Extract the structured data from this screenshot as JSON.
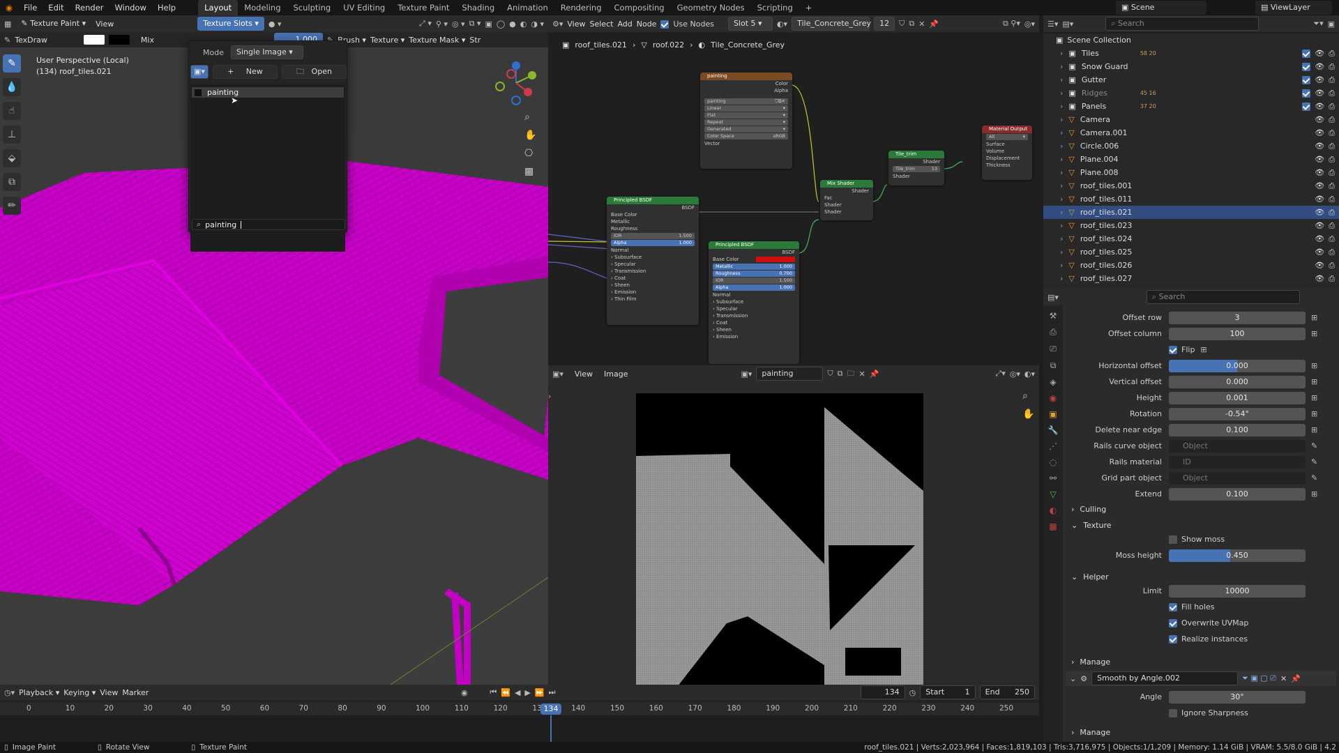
{
  "topbar": {
    "menus": [
      "File",
      "Edit",
      "Render",
      "Window",
      "Help"
    ],
    "workspaces": [
      "Layout",
      "Modeling",
      "Sculpting",
      "UV Editing",
      "Texture Paint",
      "Shading",
      "Animation",
      "Rendering",
      "Compositing",
      "Geometry Nodes",
      "Scripting"
    ],
    "active_workspace": "Layout",
    "scene": "Scene",
    "view_layer": "ViewLayer"
  },
  "viewport_header": {
    "mode": "Texture Paint",
    "view": "View",
    "texture_slots": "Texture Slots",
    "brush_name": "TexDraw",
    "blend": "Mix",
    "strength": "1.000",
    "brush": "Brush",
    "texture": "Texture",
    "texture_mask": "Texture Mask",
    "stroke": "Str"
  },
  "viewport": {
    "perspective": "User Perspective (Local)",
    "object": "(134) roof_tiles.021"
  },
  "popup": {
    "mode_label": "Mode",
    "mode_value": "Single Image",
    "new_label": "New",
    "open_label": "Open",
    "items": [
      "painting"
    ],
    "search_value": "painting"
  },
  "node_editor": {
    "menus": [
      "View",
      "Select",
      "Add",
      "Node"
    ],
    "use_nodes": "Use Nodes",
    "slot": "Slot 5",
    "material": "Tile_Concrete_Grey",
    "users": "12",
    "breadcrumb": [
      "roof_tiles.021",
      "roof.022",
      "Tile_Concrete_Grey"
    ],
    "nodes": {
      "image": {
        "title": "painting",
        "outputs": [
          "Color",
          "Alpha"
        ],
        "image": "painting",
        "fields": [
          "Linear",
          "Flat",
          "Repeat",
          "Generated"
        ],
        "color_space_label": "Color Space",
        "color_space": "sRGB",
        "vector": "Vector"
      },
      "bsdf1": {
        "title": "Principled BSDF",
        "out": "BSDF",
        "rows": [
          "Base Color",
          "Metallic",
          "Roughness"
        ],
        "ior_label": "IOR",
        "ior": "1.500",
        "alpha_label": "Alpha",
        "alpha": "1.000",
        "subs": [
          "Normal",
          "Subsurface",
          "Specular",
          "Transmission",
          "Coat",
          "Sheen",
          "Emission",
          "Thin Film"
        ]
      },
      "bsdf2": {
        "title": "Principled BSDF",
        "out": "BSDF",
        "base": "Base Color",
        "metallic_label": "Metallic",
        "metallic": "1.000",
        "roughness_label": "Roughness",
        "roughness": "0.700",
        "ior_label": "IOR",
        "ior": "1.500",
        "alpha_label": "Alpha",
        "alpha": "1.000",
        "subs": [
          "Normal",
          "Subsurface",
          "Specular",
          "Transmission",
          "Coat",
          "Sheen",
          "Emission"
        ]
      },
      "mix": {
        "title": "Mix Shader",
        "out": "Shader",
        "rows": [
          "Fac",
          "Shader",
          "Shader"
        ]
      },
      "group": {
        "title": "Tile_trim",
        "out": "Shader",
        "name": "Tile_trim",
        "users": "13",
        "input": "Shader"
      },
      "output": {
        "title": "Material Output",
        "target": "All",
        "rows": [
          "Surface",
          "Volume",
          "Displacement",
          "Thickness"
        ]
      }
    }
  },
  "image_editor": {
    "menus": [
      "View",
      "Image"
    ],
    "image_name": "painting"
  },
  "outliner": {
    "search_placeholder": "Search",
    "root": "Scene Collection",
    "rows": [
      {
        "name": "Tiles",
        "badge": "58  20",
        "type": "collection"
      },
      {
        "name": "Snow Guard",
        "badge": "",
        "type": "collection"
      },
      {
        "name": "Gutter",
        "badge": "",
        "type": "collection"
      },
      {
        "name": "Ridges",
        "badge": "45  16",
        "type": "collection"
      },
      {
        "name": "Panels",
        "badge": "37  20",
        "type": "collection"
      },
      {
        "name": "Camera",
        "badge": "",
        "type": "object"
      },
      {
        "name": "Camera.001",
        "badge": "",
        "type": "object"
      },
      {
        "name": "Circle.006",
        "badge": "",
        "type": "object"
      },
      {
        "name": "Plane.004",
        "badge": "",
        "type": "object"
      },
      {
        "name": "Plane.008",
        "badge": "",
        "type": "object"
      },
      {
        "name": "roof_tiles.001",
        "badge": "",
        "type": "object"
      },
      {
        "name": "roof_tiles.011",
        "badge": "",
        "type": "object"
      },
      {
        "name": "roof_tiles.021",
        "badge": "",
        "type": "object",
        "selected": true
      },
      {
        "name": "roof_tiles.023",
        "badge": "",
        "type": "object"
      },
      {
        "name": "roof_tiles.024",
        "badge": "",
        "type": "object"
      },
      {
        "name": "roof_tiles.025",
        "badge": "",
        "type": "object"
      },
      {
        "name": "roof_tiles.026",
        "badge": "",
        "type": "object"
      },
      {
        "name": "roof_tiles.027",
        "badge": "",
        "type": "object"
      }
    ]
  },
  "properties": {
    "search_placeholder": "Search",
    "fields": [
      {
        "label": "Offset row",
        "value": "3"
      },
      {
        "label": "Offset column",
        "value": "100"
      },
      {
        "label": "Flip",
        "check": true
      },
      {
        "label": "Horizontal offset",
        "value": "0.000",
        "fill": 0.5
      },
      {
        "label": "Vertical offset",
        "value": "0.000"
      },
      {
        "label": "Height",
        "value": "0.001"
      },
      {
        "label": "Rotation",
        "value": "-0.54°"
      },
      {
        "label": "Delete near edge",
        "value": "0.100"
      },
      {
        "label": "Rails curve object",
        "value": "Object",
        "obj": true
      },
      {
        "label": "Rails material",
        "value": "ID",
        "obj": true
      },
      {
        "label": "Grid part object",
        "value": "Object",
        "obj": true
      },
      {
        "label": "Extend",
        "value": "0.100"
      }
    ],
    "culling": "Culling",
    "texture": "Texture",
    "show_moss": "Show moss",
    "moss_height_label": "Moss height",
    "moss_height": "0.450",
    "moss_fill": 0.45,
    "helper": "Helper",
    "limit_label": "Limit",
    "limit": "10000",
    "fill_holes": "Fill holes",
    "overwrite_uvmap": "Overwrite UVMap",
    "realize_instances": "Realize instances",
    "manage": "Manage",
    "modifier_name": "Smooth by Angle.002",
    "angle_label": "Angle",
    "angle": "30°",
    "ignore_sharpness": "Ignore Sharpness",
    "manage2": "Manage"
  },
  "timeline": {
    "menus": [
      "Playback",
      "Keying",
      "View",
      "Marker"
    ],
    "current_frame": "134",
    "start_label": "Start",
    "start": "1",
    "end_label": "End",
    "end": "250",
    "ticks": [
      "0",
      "10",
      "20",
      "30",
      "40",
      "50",
      "60",
      "70",
      "80",
      "90",
      "100",
      "110",
      "120",
      "130",
      "140",
      "150",
      "160",
      "170",
      "180",
      "190",
      "200",
      "210",
      "220",
      "230",
      "240",
      "250"
    ]
  },
  "status": {
    "left1": "Image Paint",
    "left2": "Rotate View",
    "left3": "Texture Paint",
    "right": "roof_tiles.021 | Verts:2,023,964 | Faces:1,819,103 | Tris:3,716,975 | Objects:1/1,209 | Memory: 1.14 GiB | VRAM: 5.5/8.0 GiB | 4.2"
  },
  "colors": {
    "accent": "#4772b3",
    "magenta": "#d000d0",
    "node_green": "#2b7a3a",
    "node_orange": "#9e5a2a",
    "node_red": "#8a2b2b"
  }
}
